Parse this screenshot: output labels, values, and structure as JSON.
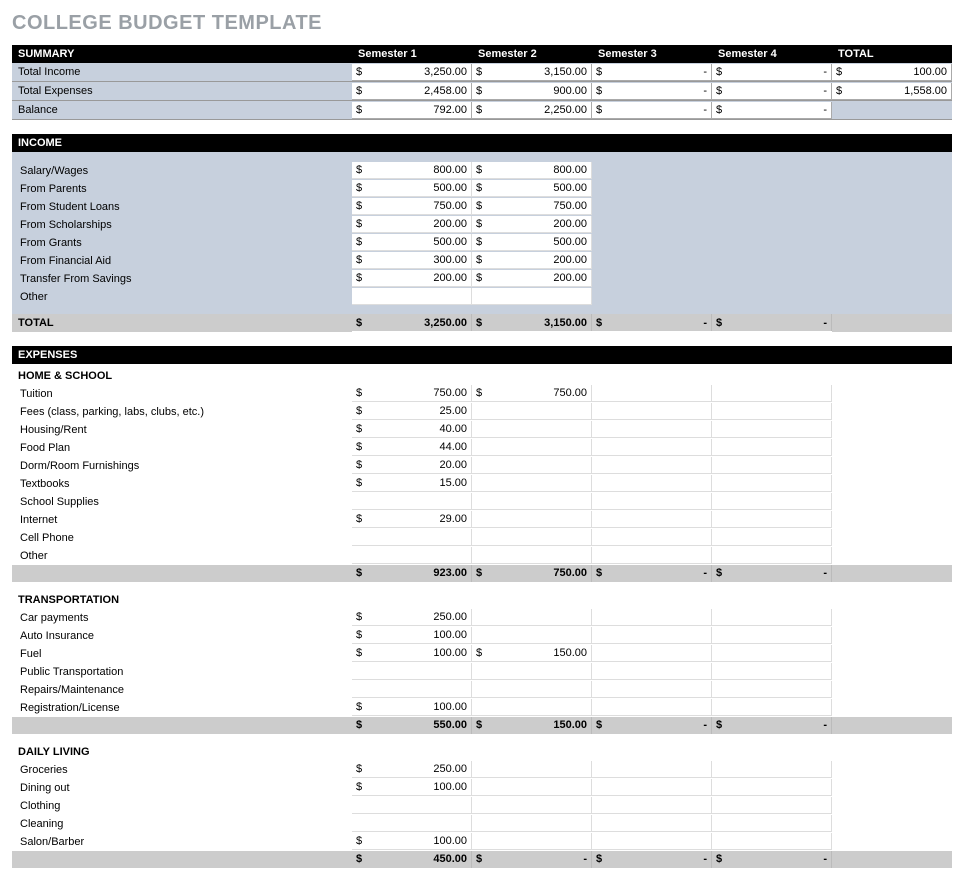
{
  "title": "COLLEGE BUDGET TEMPLATE",
  "headers": {
    "summary": "SUMMARY",
    "sem1": "Semester 1",
    "sem2": "Semester 2",
    "sem3": "Semester 3",
    "sem4": "Semester 4",
    "total": "TOTAL",
    "income": "INCOME",
    "expenses": "EXPENSES"
  },
  "summary": {
    "rows": [
      {
        "label": "Total Income",
        "s1": "3,250.00",
        "s2": "3,150.00",
        "s3": "-",
        "s4": "-",
        "total": "100.00"
      },
      {
        "label": "Total Expenses",
        "s1": "2,458.00",
        "s2": "900.00",
        "s3": "-",
        "s4": "-",
        "total": "1,558.00"
      },
      {
        "label": "Balance",
        "s1": "792.00",
        "s2": "2,250.00",
        "s3": "-",
        "s4": "-",
        "total": ""
      }
    ]
  },
  "income": {
    "items": [
      {
        "label": "Salary/Wages",
        "s1": "800.00",
        "s2": "800.00"
      },
      {
        "label": "From Parents",
        "s1": "500.00",
        "s2": "500.00"
      },
      {
        "label": "From Student Loans",
        "s1": "750.00",
        "s2": "750.00"
      },
      {
        "label": "From Scholarships",
        "s1": "200.00",
        "s2": "200.00"
      },
      {
        "label": "From Grants",
        "s1": "500.00",
        "s2": "500.00"
      },
      {
        "label": "From Financial Aid",
        "s1": "300.00",
        "s2": "200.00"
      },
      {
        "label": "Transfer From Savings",
        "s1": "200.00",
        "s2": "200.00"
      },
      {
        "label": "Other",
        "s1": "",
        "s2": ""
      }
    ],
    "total_label": "TOTAL",
    "totals": {
      "s1": "3,250.00",
      "s2": "3,150.00",
      "s3": "-",
      "s4": "-"
    }
  },
  "expenses": {
    "categories": [
      {
        "name": "HOME & SCHOOL",
        "items": [
          {
            "label": "Tuition",
            "s1": "750.00",
            "s2": "750.00"
          },
          {
            "label": "Fees (class, parking, labs, clubs, etc.)",
            "s1": "25.00",
            "s2": ""
          },
          {
            "label": "Housing/Rent",
            "s1": "40.00",
            "s2": ""
          },
          {
            "label": "Food Plan",
            "s1": "44.00",
            "s2": ""
          },
          {
            "label": "Dorm/Room Furnishings",
            "s1": "20.00",
            "s2": ""
          },
          {
            "label": "Textbooks",
            "s1": "15.00",
            "s2": ""
          },
          {
            "label": "School Supplies",
            "s1": "",
            "s2": ""
          },
          {
            "label": "Internet",
            "s1": "29.00",
            "s2": ""
          },
          {
            "label": "Cell Phone",
            "s1": "",
            "s2": ""
          },
          {
            "label": "Other",
            "s1": "",
            "s2": ""
          }
        ],
        "subtotal": {
          "s1": "923.00",
          "s2": "750.00",
          "s3": "-",
          "s4": "-"
        }
      },
      {
        "name": "TRANSPORTATION",
        "items": [
          {
            "label": "Car payments",
            "s1": "250.00",
            "s2": ""
          },
          {
            "label": "Auto Insurance",
            "s1": "100.00",
            "s2": ""
          },
          {
            "label": "Fuel",
            "s1": "100.00",
            "s2": "150.00"
          },
          {
            "label": "Public Transportation",
            "s1": "",
            "s2": ""
          },
          {
            "label": "Repairs/Maintenance",
            "s1": "",
            "s2": ""
          },
          {
            "label": "Registration/License",
            "s1": "100.00",
            "s2": ""
          }
        ],
        "subtotal": {
          "s1": "550.00",
          "s2": "150.00",
          "s3": "-",
          "s4": "-"
        }
      },
      {
        "name": "DAILY LIVING",
        "items": [
          {
            "label": "Groceries",
            "s1": "250.00",
            "s2": ""
          },
          {
            "label": "Dining out",
            "s1": "100.00",
            "s2": ""
          },
          {
            "label": "Clothing",
            "s1": "",
            "s2": ""
          },
          {
            "label": "Cleaning",
            "s1": "",
            "s2": ""
          },
          {
            "label": "Salon/Barber",
            "s1": "100.00",
            "s2": ""
          }
        ],
        "subtotal": {
          "s1": "450.00",
          "s2": "-",
          "s3": "-",
          "s4": "-"
        }
      }
    ]
  },
  "dollar": "$"
}
